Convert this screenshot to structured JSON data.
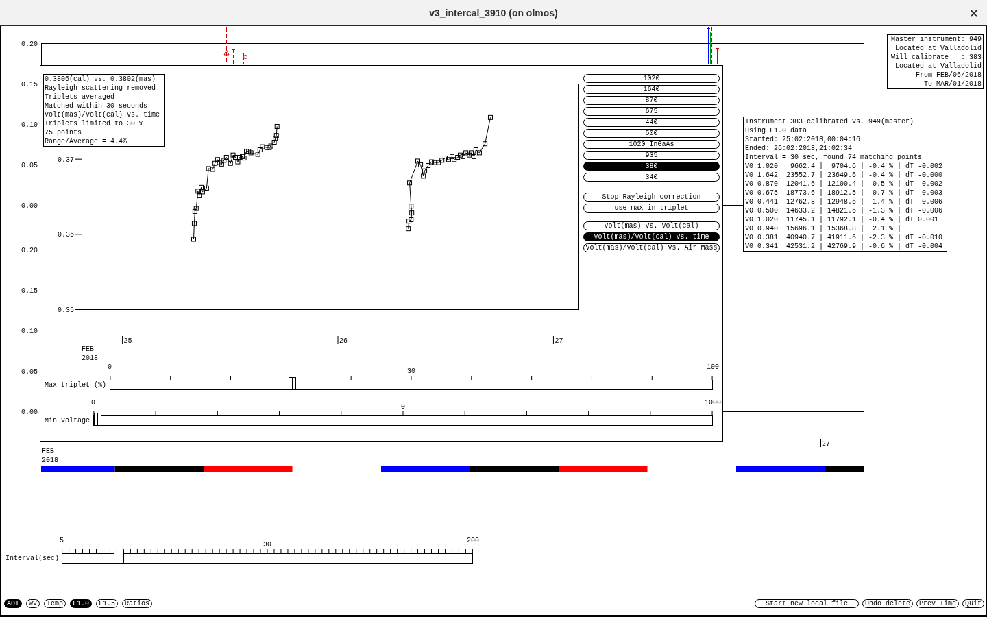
{
  "window": {
    "title": "v3_intercal_3910 (on olmos)",
    "close": "×"
  },
  "background_plot": {
    "panels": [
      {
        "yticks": [
          "0.20",
          "0.15",
          "0.10",
          "0.05",
          "0.00"
        ]
      },
      {
        "yticks": [
          "0.20",
          "0.15",
          "0.10",
          "0.05",
          "0.00"
        ]
      }
    ],
    "xticks": [
      "27"
    ],
    "date_label": "FEB 2018",
    "time_bars": [
      {
        "segments": [
          {
            "color": "#0000ff"
          },
          {
            "color": "#000000"
          },
          {
            "color": "#ff0000"
          }
        ]
      },
      {
        "segments": [
          {
            "color": "#0000ff"
          },
          {
            "color": "#000000"
          },
          {
            "color": "#ff0000"
          }
        ]
      },
      {
        "segments": [
          {
            "color": "#0000ff"
          },
          {
            "color": "#000000"
          }
        ]
      }
    ]
  },
  "master_info": [
    "Master instrument: 949",
    "Located at Valladolid",
    "Will calibrate   : 383",
    "Located at Valladolid",
    "From FEB/06/2018",
    "To MAR/01/2018"
  ],
  "calibration_info": {
    "header": [
      "Instrument 383 calibrated vs. 949(master)",
      "Using L1.0 data",
      "Started: 25:02:2018,00:04:16",
      "Ended: 26:02:2018,21:02:34",
      "Interval = 30 sec, found 74 matching points"
    ],
    "rows": [
      "V0 1.020   9662.4 |  9704.6 | -0.4 % | dT -0.002",
      "V0 1.642  23552.7 | 23649.6 | -0.4 % | dT -0.000",
      "V0 0.870  12041.6 | 12100.4 | -0.5 % | dT -0.002",
      "V0 0.675  18773.6 | 18912.5 | -0.7 % | dT -0.003",
      "V0 0.441  12762.8 | 12948.6 | -1.4 % | dT -0.006",
      "V0 0.500  14633.2 | 14821.6 | -1.3 % | dT -0.006",
      "V0 1.020  11745.1 | 11792.1 | -0.4 % | dT 0.001",
      "V0 0.940  15696.1 | 15368.8 |  2.1 % |",
      "V0 0.381  40940.7 | 41911.6 | -2.3 % | dT -0.010",
      "V0 0.341  42531.2 | 42769.9 | -0.6 % | dT -0.004"
    ]
  },
  "plot_dialog": {
    "info": [
      "0.3806(cal) vs. 0.3802(mas)",
      "Rayleigh scattering removed",
      "Triplets averaged",
      "Matched within 30 seconds",
      "Volt(mas)/Volt(cal) vs. time",
      "Triplets limited to 30 %",
      "75 points",
      "Range/Average = 4.4%"
    ],
    "chart_data": {
      "type": "line",
      "xlabel": "FEB 2018",
      "xlim": [
        24.785,
        27.094
      ],
      "ylim": [
        0.35,
        0.38
      ],
      "xticks": [
        {
          "value": 25,
          "label": "25"
        },
        {
          "value": 26,
          "label": "26"
        },
        {
          "value": 27,
          "label": "27"
        }
      ],
      "yticks": [
        {
          "value": 0.35,
          "label": "0.35"
        },
        {
          "value": 0.36,
          "label": "0.36"
        },
        {
          "value": 0.37,
          "label": "0.37"
        }
      ],
      "x": [
        25.305,
        25.308,
        25.311,
        25.317,
        25.325,
        25.331,
        25.34,
        25.346,
        25.365,
        25.374,
        25.393,
        25.404,
        25.416,
        25.425,
        25.435,
        25.446,
        25.457,
        25.476,
        25.488,
        25.499,
        25.51,
        25.518,
        25.531,
        25.539,
        25.55,
        25.56,
        25.571,
        25.603,
        25.613,
        25.624,
        25.645,
        25.656,
        25.663,
        25.679,
        25.684,
        25.689,
        25.692,
        26.301,
        26.304,
        26.314,
        26.317,
        26.314,
        26.307,
        26.345,
        26.358,
        26.371,
        26.377,
        26.393,
        26.409,
        26.425,
        26.441,
        26.457,
        26.472,
        26.488,
        26.504,
        26.514,
        26.53,
        26.542,
        26.555,
        26.568,
        26.584,
        26.593,
        26.606,
        26.615,
        26.631,
        26.657,
        26.682
      ],
      "series": [
        {
          "color": "#000000",
          "marker": "square",
          "values": [
            0.3593,
            0.3614,
            0.363,
            0.3634,
            0.3657,
            0.3651,
            0.3662,
            0.3656,
            0.3661,
            0.3687,
            0.3686,
            0.3694,
            0.3699,
            0.3695,
            0.3693,
            0.3698,
            0.3702,
            0.3694,
            0.3705,
            0.3702,
            0.3696,
            0.3702,
            0.3703,
            0.3701,
            0.371,
            0.371,
            0.3708,
            0.3706,
            0.3712,
            0.3716,
            0.3715,
            0.3715,
            0.3717,
            0.3722,
            0.3727,
            0.3731,
            0.3743,
            0.3607,
            0.3617,
            0.3619,
            0.3628,
            0.3637,
            0.3668,
            0.3697,
            0.3692,
            0.3677,
            0.3684,
            0.3691,
            0.3696,
            0.3695,
            0.3695,
            0.3698,
            0.3701,
            0.3699,
            0.3703,
            0.3699,
            0.3702,
            0.3705,
            0.3703,
            0.3708,
            0.3705,
            0.3708,
            0.3703,
            0.3712,
            0.3708,
            0.372,
            0.3755
          ]
        }
      ]
    },
    "wavelengths": [
      {
        "label": "1020",
        "selected": false
      },
      {
        "label": "1640",
        "selected": false
      },
      {
        "label": "870",
        "selected": false
      },
      {
        "label": "675",
        "selected": false
      },
      {
        "label": "440",
        "selected": false
      },
      {
        "label": "500",
        "selected": false
      },
      {
        "label": "1020 InGaAs",
        "selected": false
      },
      {
        "label": "935",
        "selected": false
      },
      {
        "label": "380",
        "selected": true
      },
      {
        "label": "340",
        "selected": false
      }
    ],
    "options": [
      "Stop Rayleigh correction",
      "use max in triplet"
    ],
    "plot_modes": [
      {
        "label": "Volt(mas) vs. Volt(cal)",
        "selected": false
      },
      {
        "label": "Volt(mas)/Volt(cal) vs. time",
        "selected": true
      },
      {
        "label": "Volt(mas)/Volt(cal) vs. Air Mass",
        "selected": false
      }
    ],
    "sliders": [
      {
        "label": "Max triplet (%)",
        "min": "0",
        "value": "30",
        "max": "100",
        "level": 0.3
      },
      {
        "label": "Min Voltage",
        "min": "0",
        "value": "0",
        "max": "1000",
        "level": 0
      }
    ]
  },
  "interval_slider": {
    "label": "Interval(sec)",
    "min": "5",
    "value": "30",
    "max": "200",
    "level": 0.128
  },
  "data_buttons": [
    {
      "label": "AOT",
      "selected": true
    },
    {
      "label": "WV",
      "selected": false
    },
    {
      "label": "Temp",
      "selected": false
    },
    {
      "label": "L1.0",
      "selected": true
    },
    {
      "label": "L1.5",
      "selected": false
    },
    {
      "label": "Ratios",
      "selected": false
    }
  ],
  "actions": [
    "Start new local file",
    "Undo delete",
    "Prev Time",
    "Quit"
  ]
}
